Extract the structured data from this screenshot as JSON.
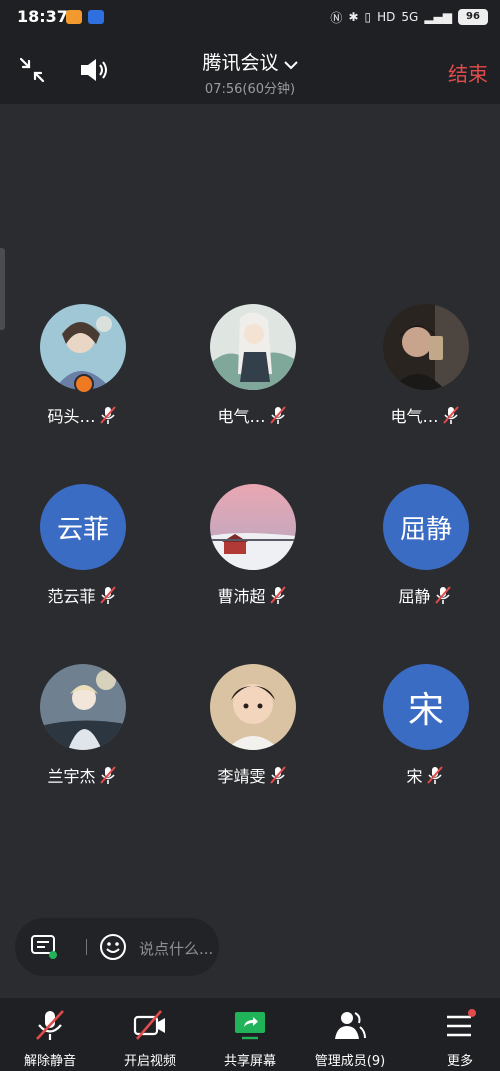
{
  "status_bar": {
    "time": "18:37",
    "network_text": "5G",
    "battery": "96"
  },
  "header": {
    "title": "腾讯会议",
    "timer": "07:56(60分钟)",
    "end_label": "结束"
  },
  "participants": [
    {
      "name": "码头…",
      "avatar_type": "photo",
      "muted": true,
      "host": true
    },
    {
      "name": "电气…",
      "avatar_type": "photo",
      "muted": true,
      "host": false
    },
    {
      "name": "电气…",
      "avatar_type": "photo",
      "muted": true,
      "host": false
    },
    {
      "name": "范云菲",
      "avatar_type": "text",
      "avatar_text": "云菲",
      "muted": true,
      "host": false
    },
    {
      "name": "曹沛超",
      "avatar_type": "photo",
      "muted": true,
      "host": false
    },
    {
      "name": "屈静",
      "avatar_type": "text",
      "avatar_text": "屈静",
      "muted": true,
      "host": false
    },
    {
      "name": "兰宇杰",
      "avatar_type": "photo",
      "muted": true,
      "host": false
    },
    {
      "name": "李靖雯",
      "avatar_type": "photo",
      "muted": true,
      "host": false
    },
    {
      "name": "宋",
      "avatar_type": "text",
      "avatar_text": "宋",
      "muted": true,
      "host": false
    }
  ],
  "chat": {
    "placeholder": "说点什么..."
  },
  "toolbar": {
    "unmute_label": "解除静音",
    "video_label": "开启视频",
    "share_label": "共享屏幕",
    "members_label": "管理成员(9)",
    "more_label": "更多"
  },
  "colors": {
    "background": "#2b2c30",
    "bar": "#1f2023",
    "end_red": "#e24b4b",
    "avatar_blue": "#3b6cc4",
    "share_green": "#21b35a",
    "mute_red": "#e24b4b"
  }
}
